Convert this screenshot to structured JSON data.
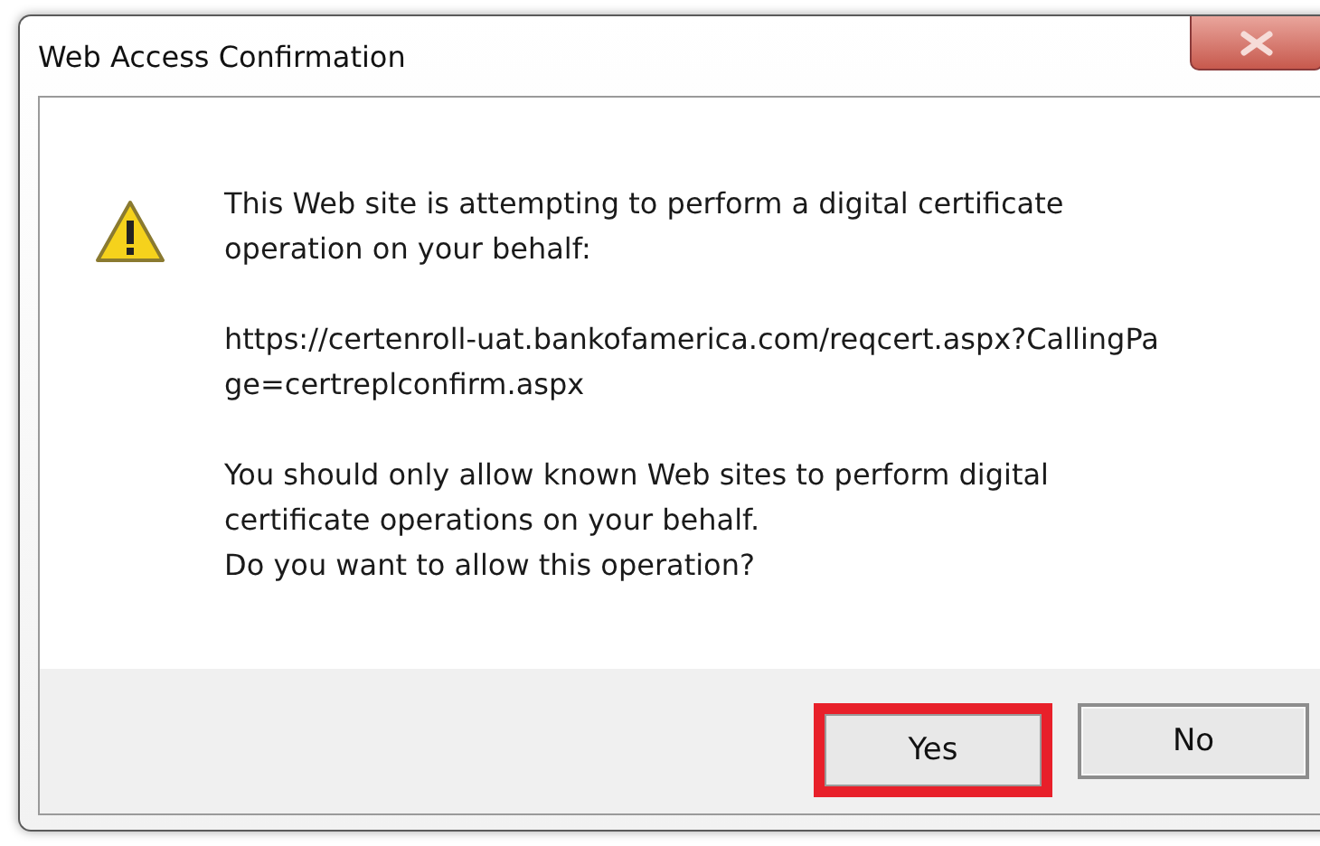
{
  "window": {
    "title": "Web Access Confirmation"
  },
  "message": [
    {
      "lines": [
        "This Web site is attempting to perform a digital certificate",
        "operation on your behalf:"
      ]
    },
    {
      "lines": [
        "https://certenroll-uat.bankofamerica.com/reqcert.aspx?CallingPa",
        "ge=certreplconfirm.aspx"
      ]
    },
    {
      "lines": [
        "You should only allow known Web sites to perform digital",
        "certificate operations on your behalf.",
        "Do you want to allow this operation?"
      ]
    }
  ],
  "buttons": [
    {
      "label": "Yes",
      "highlighted": true
    },
    {
      "label": "No",
      "highlighted": false
    }
  ]
}
